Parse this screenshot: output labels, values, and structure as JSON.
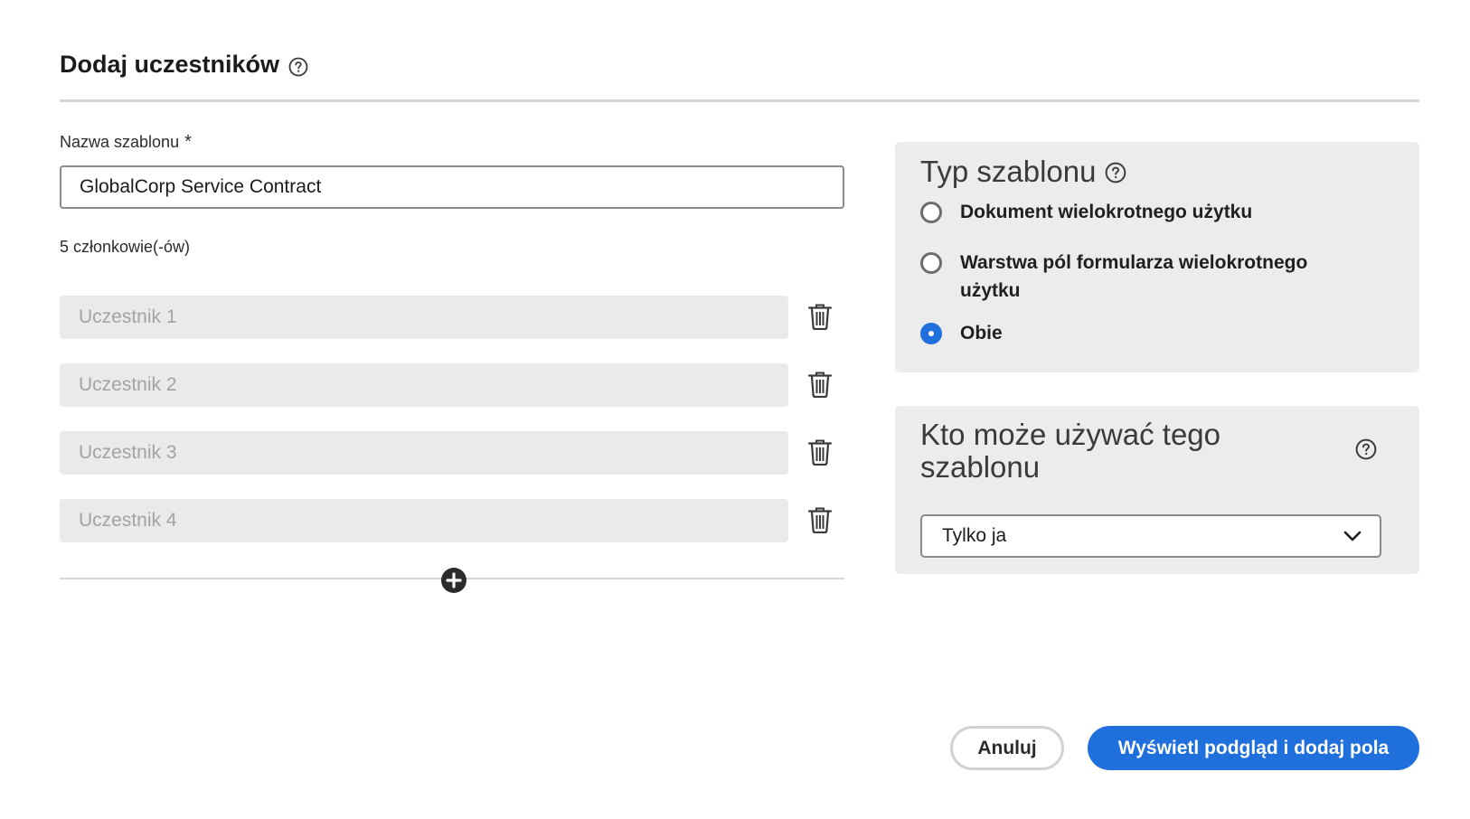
{
  "dialog": {
    "title": "Dodaj uczestników"
  },
  "template_name": {
    "label": "Nazwa szablonu",
    "required_mark": "*",
    "value": "GlobalCorp Service Contract"
  },
  "members": {
    "count_text": "5 członkowie(-ów)",
    "participants": [
      {
        "placeholder": "Uczestnik 1"
      },
      {
        "placeholder": "Uczestnik 2"
      },
      {
        "placeholder": "Uczestnik 3"
      },
      {
        "placeholder": "Uczestnik 4"
      }
    ]
  },
  "template_type": {
    "title": "Typ szablonu",
    "options": [
      {
        "label": "Dokument wielokrotnego użytku",
        "selected": false
      },
      {
        "label": "Warstwa pól formularza wielokrotnego użytku",
        "selected": false
      },
      {
        "label": "Obie",
        "selected": true
      }
    ]
  },
  "who_can_use": {
    "title": "Kto może używać tego szablonu",
    "selected": "Tylko ja"
  },
  "actions": {
    "cancel_label": "Anuluj",
    "primary_label": "Wyświetl podgląd i dodaj pola"
  },
  "colors": {
    "accent": "#1f6fdc",
    "panel_bg": "#ececec",
    "input_bg": "#eaeaea"
  }
}
